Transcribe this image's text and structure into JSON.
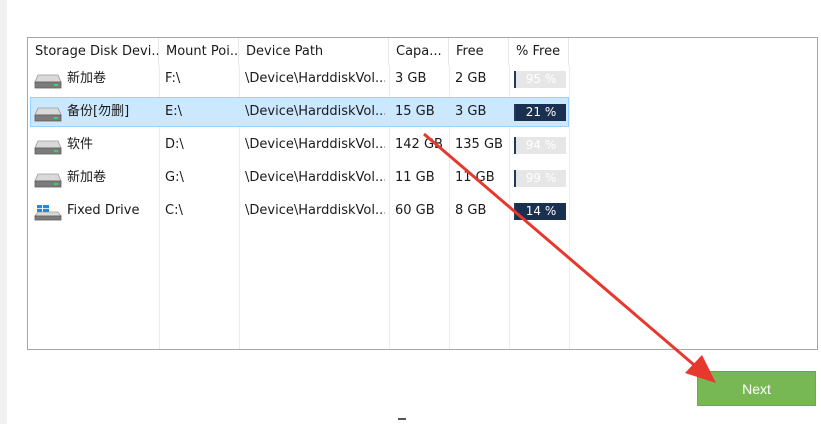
{
  "columns": [
    "Storage Disk Devi...",
    "Mount Poi...",
    "Device Path",
    "Capa...",
    "Free",
    "% Free"
  ],
  "rows": [
    {
      "name": "新加卷",
      "mount": "F:\\",
      "path": "\\Device\\HarddiskVol...",
      "capacity": "3 GB",
      "free": "2 GB",
      "percent": "95 %",
      "fraction": 0.95,
      "icon": "hard-drive-icon",
      "selected": false
    },
    {
      "name": "备份[勿删]",
      "mount": "E:\\",
      "path": "\\Device\\HarddiskVol...",
      "capacity": "15 GB",
      "free": "3 GB",
      "percent": "21 %",
      "fraction": 0.21,
      "icon": "hard-drive-icon",
      "selected": true
    },
    {
      "name": "软件",
      "mount": "D:\\",
      "path": "\\Device\\HarddiskVol...",
      "capacity": "142 GB",
      "free": "135 GB",
      "percent": "94 %",
      "fraction": 0.94,
      "icon": "hard-drive-icon",
      "selected": false
    },
    {
      "name": "新加卷",
      "mount": "G:\\",
      "path": "\\Device\\HarddiskVol...",
      "capacity": "11 GB",
      "free": "11 GB",
      "percent": "99 %",
      "fraction": 0.99,
      "icon": "hard-drive-icon",
      "selected": false
    },
    {
      "name": "Fixed Drive",
      "mount": "C:\\",
      "path": "\\Device\\HarddiskVol...",
      "capacity": "60 GB",
      "free": "8 GB",
      "percent": "14 %",
      "fraction": 0.14,
      "icon": "windows-drive-icon",
      "selected": false
    }
  ],
  "next_label": "Next",
  "colors": {
    "selection": "#cce8ff",
    "bar_fill": "#1a3050",
    "bar_empty": "#e6e6e6",
    "next_button": "#78b854",
    "annotation_arrow": "#e8372c"
  }
}
